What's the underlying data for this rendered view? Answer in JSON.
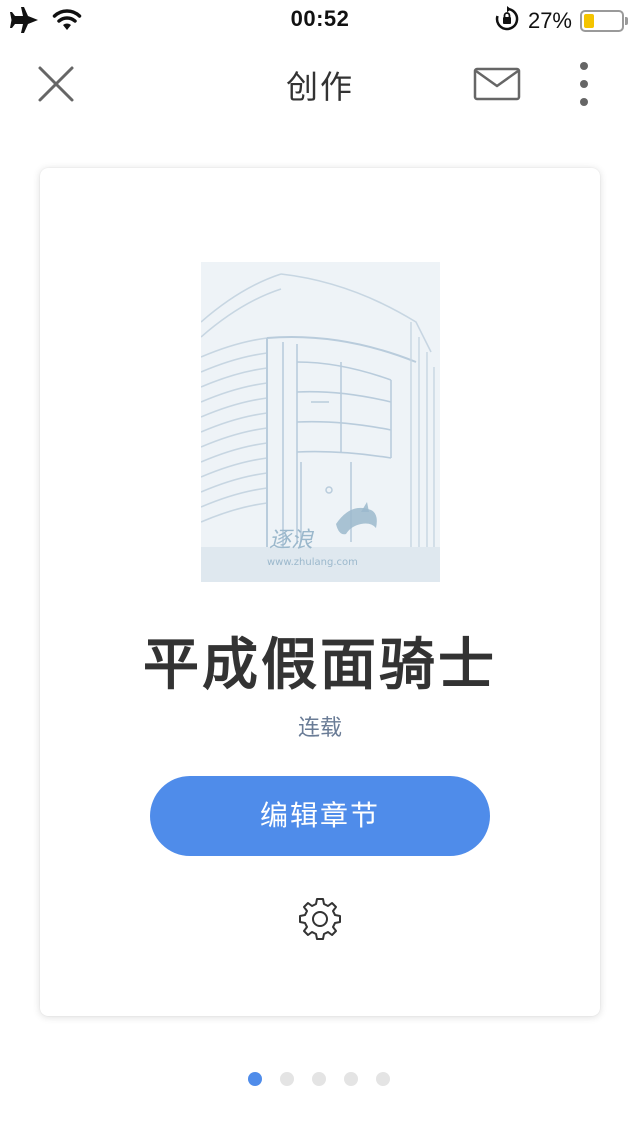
{
  "status_bar": {
    "time": "00:52",
    "battery_percent_text": "27%",
    "battery_level": 0.27,
    "battery_color": "#f4c400",
    "icons": [
      "airplane-icon",
      "wifi-icon",
      "rotation-lock-icon",
      "battery-icon"
    ]
  },
  "nav": {
    "title": "创作",
    "left_icon": "close-icon",
    "right_icons": [
      "mail-icon",
      "more-vertical-icon"
    ]
  },
  "card": {
    "cover": {
      "watermark_brand": "逐浪",
      "watermark_url": "www.zhulang.com"
    },
    "title": "平成假面骑士",
    "status": "连载",
    "edit_button_label": "编辑章节",
    "settings_icon": "gear-icon"
  },
  "pagination": {
    "total": 5,
    "active_index": 0
  },
  "colors": {
    "accent": "#4f8cea",
    "title_text": "#333333",
    "status_text": "#6a7c96",
    "dot_inactive": "#e4e4e4"
  }
}
